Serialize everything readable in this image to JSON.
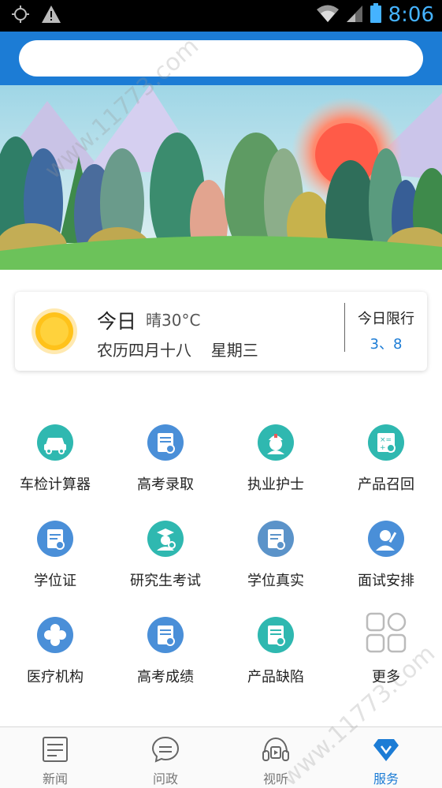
{
  "status_bar": {
    "time": "8:06",
    "icons": [
      "gps-icon",
      "warning-icon",
      "wifi-icon",
      "signal-icon",
      "battery-icon"
    ]
  },
  "search": {
    "placeholder": ""
  },
  "banner": {
    "description": ""
  },
  "weather": {
    "today_label": "今日",
    "condition": "晴30°C",
    "lunar_date": "农历四月十八",
    "weekday": "星期三",
    "limit_title": "今日限行",
    "limit_value": "3、8"
  },
  "services": [
    {
      "label": "车检计算器",
      "icon": "car-calculator-icon",
      "color": "#2fb8b0"
    },
    {
      "label": "高考录取",
      "icon": "exam-admission-icon",
      "color": "#4a8fd8"
    },
    {
      "label": "执业护士",
      "icon": "nurse-icon",
      "color": "#2fb8b0"
    },
    {
      "label": "产品召回",
      "icon": "product-recall-icon",
      "color": "#2fb8b0"
    },
    {
      "label": "学位证",
      "icon": "degree-certificate-icon",
      "color": "#4a8fd8"
    },
    {
      "label": "研究生考试",
      "icon": "graduate-exam-icon",
      "color": "#2fb8b0"
    },
    {
      "label": "学位真实",
      "icon": "degree-verify-icon",
      "color": "#5b93c9"
    },
    {
      "label": "面试安排",
      "icon": "interview-icon",
      "color": "#4a8fd8"
    },
    {
      "label": "医疗机构",
      "icon": "medical-institution-icon",
      "color": "#4a8fd8"
    },
    {
      "label": "高考成绩",
      "icon": "exam-score-icon",
      "color": "#4a8fd8"
    },
    {
      "label": "产品缺陷",
      "icon": "product-defect-icon",
      "color": "#2fb8b0"
    },
    {
      "label": "更多",
      "icon": "more-grid-icon",
      "color": "#bbbbbb"
    }
  ],
  "nav": [
    {
      "label": "新闻",
      "icon": "news-icon",
      "active": false
    },
    {
      "label": "问政",
      "icon": "chat-icon",
      "active": false
    },
    {
      "label": "视听",
      "icon": "headphones-icon",
      "active": false
    },
    {
      "label": "服务",
      "icon": "service-icon",
      "active": true
    }
  ],
  "watermark": "www.11773.com",
  "colors": {
    "primary": "#1c7cd5",
    "teal": "#2fb8b0",
    "status_bar": "#000000"
  }
}
